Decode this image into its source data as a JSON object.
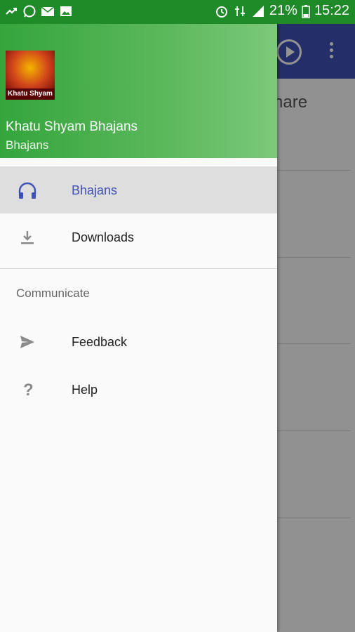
{
  "status_bar": {
    "battery": "21%",
    "time": "15:22",
    "icons": [
      "missed-call-icon",
      "whatsapp-icon",
      "email-icon",
      "image-icon",
      "alarm-icon",
      "data-icon",
      "signal-icon",
      "battery-icon"
    ]
  },
  "background_app": {
    "partial_text": "hare"
  },
  "drawer": {
    "header": {
      "logo_caption": "Khatu Shyam",
      "title": "Khatu Shyam Bhajans",
      "subtitle": "Bhajans"
    },
    "items": [
      {
        "label": "Bhajans",
        "icon": "headphones-icon",
        "selected": true
      },
      {
        "label": "Downloads",
        "icon": "download-icon",
        "selected": false
      }
    ],
    "section_header": "Communicate",
    "section_items": [
      {
        "label": "Feedback",
        "icon": "send-icon"
      },
      {
        "label": "Help",
        "icon": "help-icon"
      }
    ]
  },
  "colors": {
    "accent": "#3f51b5",
    "header_green": "#34a53c",
    "status_bar": "#1e8a28"
  }
}
